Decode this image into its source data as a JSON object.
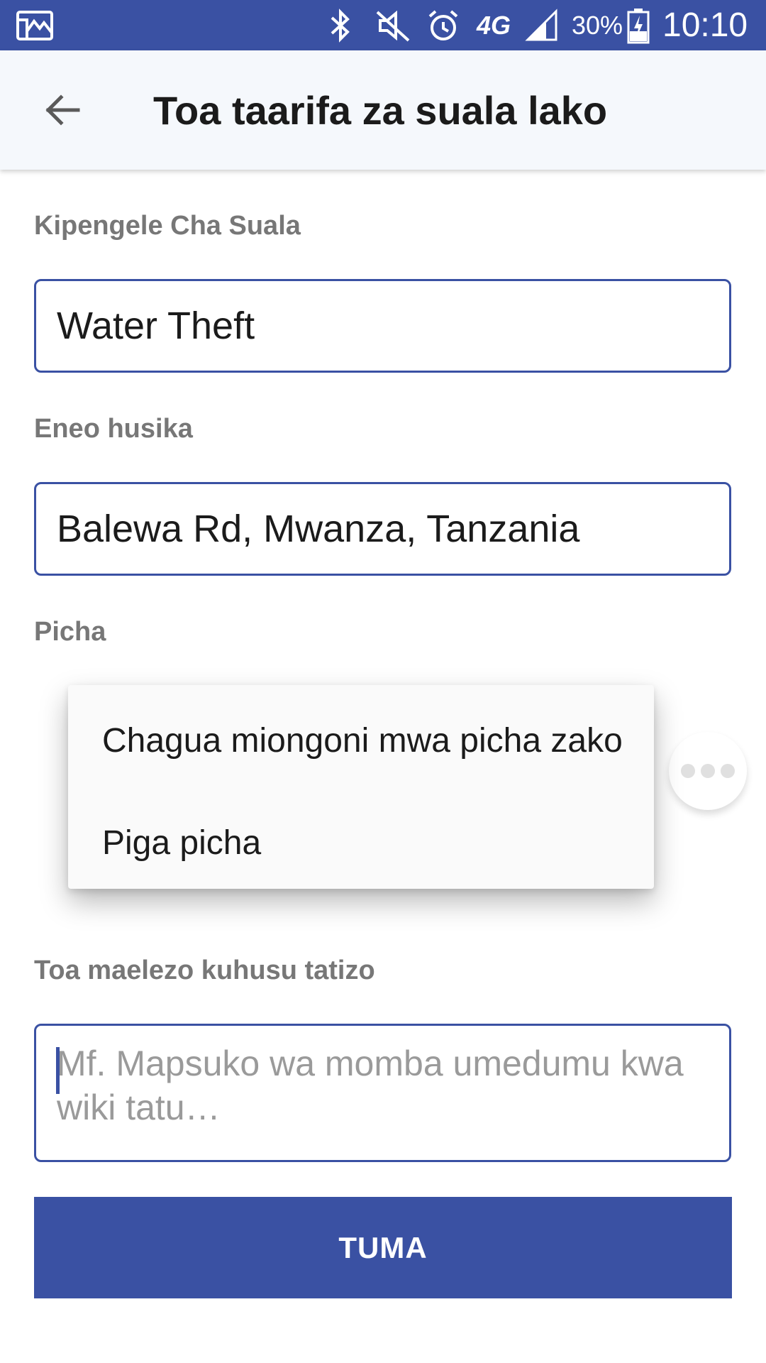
{
  "status_bar": {
    "battery": "30%",
    "time": "10:10",
    "network": "4G",
    "icons": [
      "gallery-notification-icon",
      "bluetooth-icon",
      "mute-icon",
      "alarm-icon",
      "network-4g-icon",
      "signal-icon",
      "battery-charging-icon"
    ]
  },
  "app_bar": {
    "title": "Toa taarifa za suala lako",
    "back_icon": "arrow-back-icon"
  },
  "form": {
    "category_label": "Kipengele Cha Suala",
    "category_value": "Water Theft",
    "location_label": "Eneo husika",
    "location_value": "Balewa Rd, Mwanza, Tanzania",
    "photo_label": "Picha",
    "description_label": "Toa maelezo kuhusu tatizo",
    "description_placeholder": "Mf. Mapsuko wa momba umedumu kwa wiki tatu…",
    "description_value": "",
    "submit_label": "TUMA"
  },
  "photo_menu": {
    "items": [
      {
        "label": "Chagua miongoni mwa picha zako"
      },
      {
        "label": "Piga picha"
      }
    ]
  },
  "colors": {
    "primary": "#3a51a3",
    "app_bar_bg": "#f5f8fc",
    "label_gray": "#777777",
    "placeholder_gray": "#9a9a9a"
  }
}
